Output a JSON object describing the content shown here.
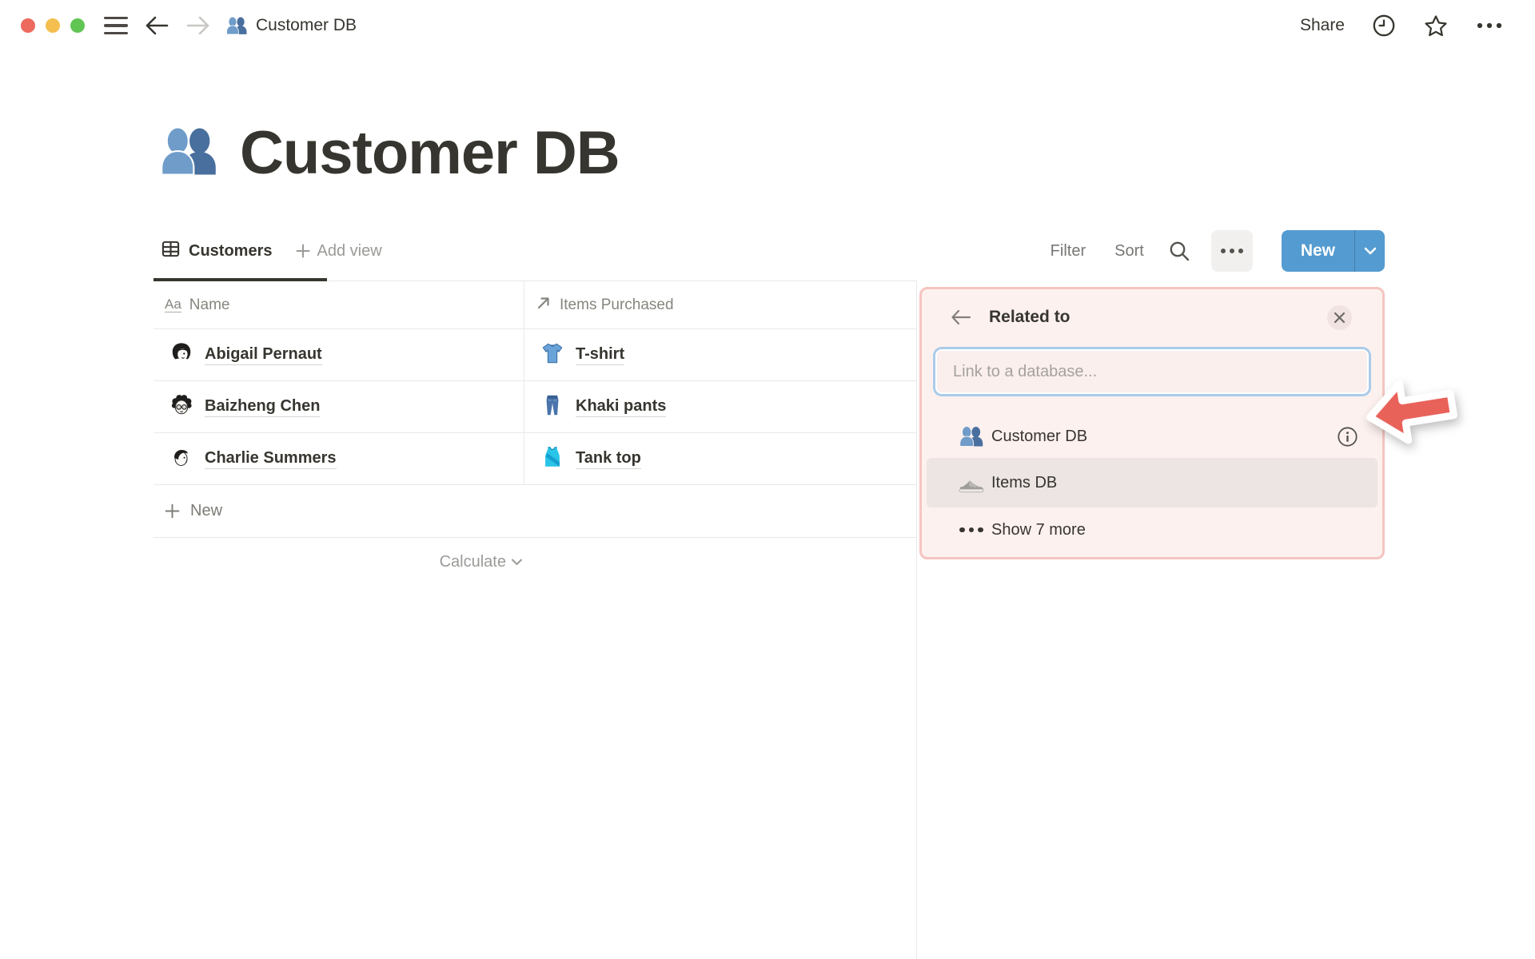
{
  "titlebar": {
    "document_title": "Customer DB",
    "share_label": "Share"
  },
  "page": {
    "title": "Customer DB",
    "emoji_icon": "busts-in-silhouette"
  },
  "toolbar": {
    "active_view_label": "Customers",
    "add_view_label": "Add view",
    "filter_label": "Filter",
    "sort_label": "Sort",
    "new_button_label": "New"
  },
  "table": {
    "columns": [
      {
        "label": "Name",
        "icon_glyph": "Aa",
        "type_icon": "text-property-icon"
      },
      {
        "label": "Items Purchased",
        "type_icon": "relation-property-icon"
      }
    ],
    "rows": [
      {
        "name": "Abigail Pernaut",
        "avatar_icon": "woman-bob-hair-avatar",
        "item": "T-shirt",
        "item_icon": "tshirt-icon"
      },
      {
        "name": "Baizheng Chen",
        "avatar_icon": "curly-hair-glasses-avatar",
        "item": "Khaki pants",
        "item_icon": "jeans-icon"
      },
      {
        "name": "Charlie Summers",
        "avatar_icon": "side-profile-avatar",
        "item": "Tank top",
        "item_icon": "tank-top-icon"
      }
    ],
    "new_row_label": "New",
    "calculate_label": "Calculate"
  },
  "popup": {
    "title": "Related to",
    "search_placeholder": "Link to a database...",
    "items": [
      {
        "label": "Customer DB",
        "icon": "busts-icon",
        "has_info": true
      },
      {
        "label": "Items DB",
        "icon": "sneaker-icon",
        "highlighted": true
      },
      {
        "label": "Show 7 more",
        "icon": "ellipsis-icon"
      }
    ]
  },
  "colors": {
    "accent_blue": "#549BD1",
    "popup_background": "#FDF1EF",
    "popup_border": "#F5C5C0",
    "highlighted_row": "#ECE5E3",
    "annotation_arrow_red": "#E8625A",
    "table_line": "#E9E9E7",
    "traffic_red": "#EC6A5E",
    "traffic_yellow": "#F4BF4F",
    "traffic_green": "#61C554"
  }
}
